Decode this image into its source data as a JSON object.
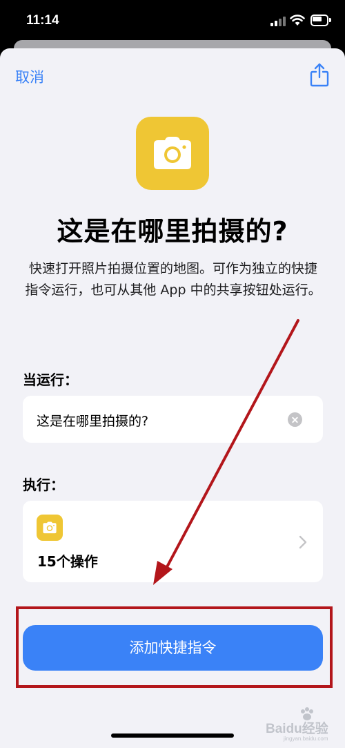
{
  "status_bar": {
    "time": "11:14"
  },
  "header": {
    "cancel_label": "取消",
    "share_icon": "share-icon"
  },
  "shortcut": {
    "icon": "camera-icon",
    "icon_color": "#efc634",
    "title": "这是在哪里拍摄的?",
    "description": "快速打开照片拍摄位置的地图。可作为独立的快捷指令运行，也可从其他 App 中的共享按钮处运行。"
  },
  "run_section": {
    "label": "当运行：",
    "phrase_value": "这是在哪里拍摄的?"
  },
  "exec_section": {
    "label": "执行：",
    "actions_count": "15个操作"
  },
  "add_button_label": "添加快捷指令",
  "colors": {
    "accent": "#3a82f7",
    "annotation": "#b3161b",
    "sheet_bg": "#f2f2f7"
  },
  "watermark": {
    "text": "Baidu经验",
    "sub": "jingyan.baidu.com"
  }
}
